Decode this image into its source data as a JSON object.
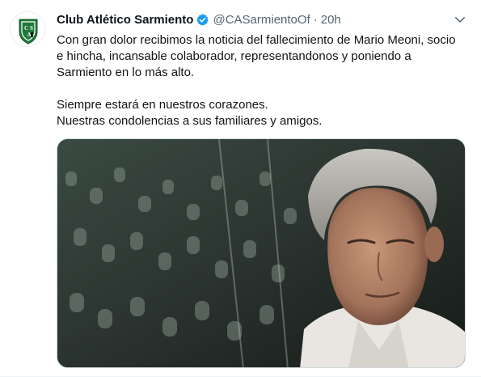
{
  "tweet": {
    "display_name": "Club Atlético Sarmiento",
    "handle": "@CASarmientoOf",
    "separator": "·",
    "time": "20h",
    "avatar_logo_text": "CAS",
    "lines": [
      "Con gran dolor recibimos la noticia del fallecimiento de Mario Meoni, socio",
      "e hincha, incansable colaborador, representandonos y poniendo a",
      "Sarmiento en lo más alto."
    ],
    "lines2": [
      "Siempre estará en nuestros corazones.",
      "Nuestras condolencias a sus familiares y amigos."
    ],
    "media": {
      "description_icon": "photo-of-man-in-stadium"
    }
  },
  "colors": {
    "text": "#0f1419",
    "secondary_text": "#536471",
    "verified_blue": "#1d9bf0",
    "club_green": "#1f7a3a"
  }
}
